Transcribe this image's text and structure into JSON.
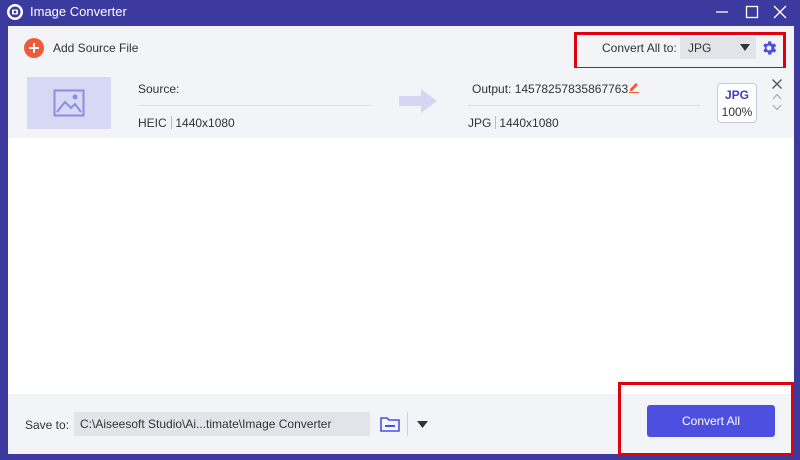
{
  "window": {
    "title": "Image Converter",
    "icons": {
      "logo": "app-logo-icon",
      "minimize": "minimize-icon",
      "maximize": "maximize-icon",
      "close": "close-icon"
    }
  },
  "toolbar": {
    "add_source_label": "Add Source File",
    "add_icon": "plus-circle-icon",
    "convert_all_to_label": "Convert All to:",
    "convert_all_format": "JPG",
    "settings_icon": "gear-icon"
  },
  "file_item": {
    "source_label": "Source:",
    "source_format": "HEIC",
    "source_resolution": "1440x1080",
    "output_label": "Output: 14578257835867763",
    "output_format": "JPG",
    "output_resolution": "1440x1080",
    "badge_format": "JPG",
    "badge_quality": "100%",
    "icons": {
      "thumbnail": "image-placeholder-icon",
      "arrow": "arrow-right-icon",
      "edit": "pencil-icon",
      "remove": "close-icon",
      "up": "chevron-up-icon",
      "down": "chevron-down-icon"
    }
  },
  "footer": {
    "save_to_label": "Save to:",
    "save_path": "C:\\Aiseesoft Studio\\Ai...timate\\Image Converter",
    "folder_icon": "folder-icon",
    "convert_all_button": "Convert All"
  },
  "colors": {
    "frame": "#3c3a9e",
    "accent": "#4d4fe0",
    "add_icon": "#f05a3a",
    "highlight_box": "#e0000f",
    "thumbnail_bg": "#d7d8f4"
  }
}
